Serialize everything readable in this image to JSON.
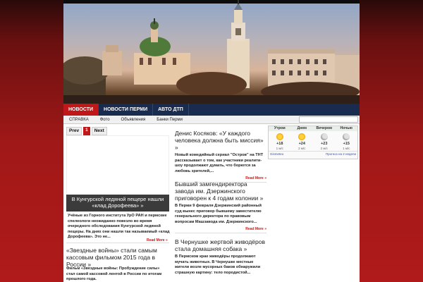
{
  "nav_main": [
    {
      "label": "НОВОСТИ",
      "active": true
    },
    {
      "label": "НОВОСТИ ПЕРМИ",
      "active": false
    },
    {
      "label": "АВТО ДТП",
      "active": false
    }
  ],
  "nav_sub": [
    "СПРАВКА",
    "Фото",
    "Объявления",
    "Банки Перми"
  ],
  "pager": {
    "prev": "Prev",
    "page": "1",
    "next": "Next"
  },
  "featured": {
    "caption": "В Кунгурской ледяной пещере нашли «клад Дорофеева» »",
    "teaser": "Учёные из Горного института УрО РАН и пермские спелеологи неожиданно повезло во время очередного обследования Кунгурской ледяной пещеры. На днях они нашли так называемый «клад Дорофеева». Это не...",
    "more": "Read More »"
  },
  "left_article": {
    "title": "«Звездные войны» стали самым кассовым фильмом 2015 года в России »",
    "desc": "Фильм «Звездные войны: Пробуждение силы» стал самой кассовой лентой в России по итогам прошлого года."
  },
  "articles": [
    {
      "title": "Денис Косяков: «У каждого человека должна быть миссия» »",
      "desc": "Новый комедийный сериал \"Остров\" на ТНТ рассказывает о том, как участники реалити-шоу продолжают думать, что борются за любовь зрителей,...",
      "more": "Read More »"
    },
    {
      "title": "Бывший замгендиректора завода им. Дзержинского приговорен к 4 годам колонии »",
      "desc": "В Перми 9 февраля Дзержинский районный суд вынес приговор бывшему заместителю генерального директора по правовым вопросам Машзавода им. Дзержинского...",
      "more": "Read More »"
    },
    {
      "title": "В Чернушке жертвой живодёров стала домашняя собака »",
      "desc": "В Пермском крае живодёры продолжают мучать животных. В Чернушке местные жители возле мусорных баков обнаружили страшную картину: тело породистой..."
    }
  ],
  "weather": {
    "periods": [
      {
        "label": "Утром",
        "icon": "sun",
        "temp": "+18",
        "wind": "1 м/с"
      },
      {
        "label": "Днем",
        "icon": "sun",
        "temp": "+24",
        "wind": "2 м/с"
      },
      {
        "label": "Вечером",
        "icon": "moon",
        "temp": "+23",
        "wind": "2 м/с"
      },
      {
        "label": "Ночью",
        "icon": "moon",
        "temp": "+15",
        "wind": "1 м/с"
      }
    ],
    "source": "Gismeteo",
    "forecast_link": "Прогноз на 2 недели"
  },
  "colors": {
    "accent": "#c01818",
    "nav": "#1a2b50"
  }
}
